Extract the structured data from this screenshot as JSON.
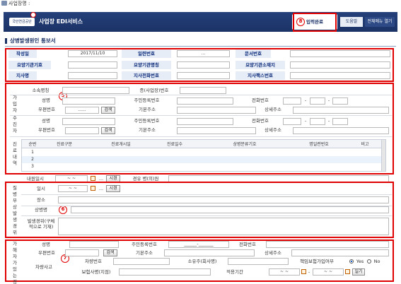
{
  "top": {
    "title": "사업장명 :"
  },
  "header": {
    "logo": "국민연금공단",
    "service_title": "사업장 EDI서비스",
    "input_complete": "입력완료",
    "help": "도움말",
    "open_all_menu": "전체메뉴 열기"
  },
  "page": {
    "title": "상병발생원인 통보서"
  },
  "markers": {
    "m5": "5",
    "m6": "6",
    "m7": "7",
    "m8": "8"
  },
  "sec1": {
    "write_date_label": "작성일",
    "write_date_value": "2017/11/10",
    "serial_label": "일련번호",
    "serial_value": "...",
    "doc_no_label": "문서번호",
    "care_code_label": "요양기관기호",
    "care_name_label": "요양기관명칭",
    "care_addr_label": "요양기관소재지",
    "branch_name_label": "지사명",
    "branch_phone_label": "지사전화번호",
    "branch_fax_label": "지사팩스번호"
  },
  "sec2": {
    "office_name_label": "소속명칭",
    "biz_no_label": "증(사업장)번호",
    "subscriber_side": "가입자",
    "receiver_side": "수진자",
    "name_label": "성명",
    "rrn_label": "주민등록번호",
    "phone_label": "전화번호",
    "dash": "-",
    "zip_label": "우편번호",
    "zip_value": "......",
    "search_btn": "검색",
    "addr_label": "기본주소",
    "detail_addr_label": "상세주소",
    "medical_side": "진료내역",
    "columns": [
      "순번",
      "진료구분",
      "진료개시일",
      "진료일수",
      "상병분류기호",
      "명일련번호",
      "비고"
    ],
    "rows": [
      "1",
      "2",
      "3"
    ]
  },
  "sec3": {
    "visit_date_label": "내원일시",
    "visit_value": "~ ~",
    "ellipsis": "...",
    "time_btn": "시경",
    "route_label": "경유 병(의)원",
    "side": "질병부상발생경위",
    "date_label": "일시",
    "date_value": "~ ~",
    "place_label": "장소",
    "disease_label": "상병명",
    "cause_label": "발생경위(구체적으로 기재)"
  },
  "sec4": {
    "side": "가해자가있는경우",
    "name_label": "성명",
    "rrn_label": "주민등록번호",
    "rrn_value": "______-_______",
    "phone_label": "전화번호",
    "zip_label": "우편번호",
    "search_btn": "검색",
    "addr_label": "기본주소",
    "detail_addr_label": "상세주소",
    "accident_label": "차량사고",
    "car_no_label": "차량번호",
    "owner_label": "소유주(회사명)",
    "liability_label": "책임보험가입여부",
    "yes": "Yes",
    "no": "No",
    "insurer_label": "보험사명(지점)",
    "period_label": "적용기간",
    "period_value": "~ ~",
    "time_btn": "일기"
  }
}
